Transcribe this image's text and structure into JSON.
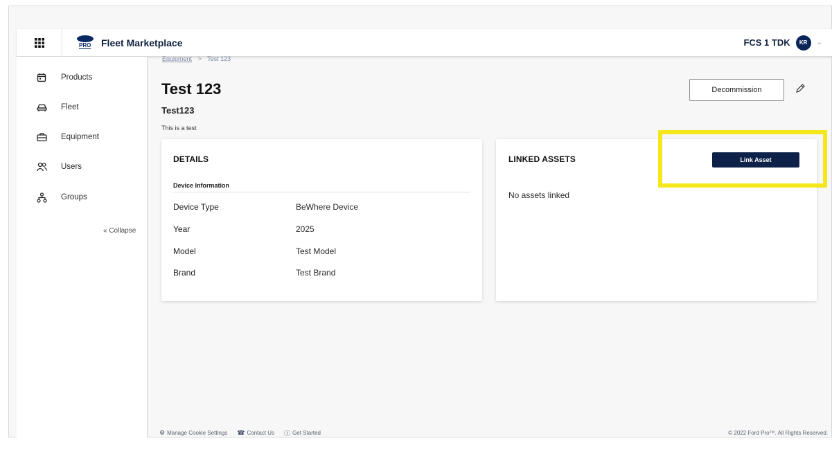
{
  "header": {
    "brand_title": "Fleet Marketplace",
    "logo_text": "PRO",
    "org_name": "FCS 1 TDK",
    "avatar_initials": "KR"
  },
  "sidebar": {
    "items": [
      {
        "label": "Products",
        "icon": "calendar-icon"
      },
      {
        "label": "Fleet",
        "icon": "car-icon"
      },
      {
        "label": "Equipment",
        "icon": "briefcase-icon"
      },
      {
        "label": "Users",
        "icon": "users-icon"
      },
      {
        "label": "Groups",
        "icon": "hierarchy-icon"
      }
    ],
    "collapse_label": "« Collapse"
  },
  "breadcrumb": {
    "parent": "Equipment",
    "separator": ">",
    "current": "Test 123"
  },
  "page": {
    "title": "Test 123",
    "subtitle": "Test123",
    "description": "This is a test",
    "decommission_label": "Decommission"
  },
  "details": {
    "heading": "DETAILS",
    "section_label": "Device Information",
    "rows": [
      {
        "key": "Device Type",
        "value": "BeWhere Device"
      },
      {
        "key": "Year",
        "value": "2025"
      },
      {
        "key": "Model",
        "value": "Test Model"
      },
      {
        "key": "Brand",
        "value": "Test Brand"
      }
    ]
  },
  "linked_assets": {
    "heading": "LINKED ASSETS",
    "empty_text": "No assets linked",
    "link_button_label": "Link Asset"
  },
  "footer": {
    "cookie_label": "Manage Cookie Settings",
    "contact_label": "Contact Us",
    "started_label": "Get Started",
    "copyright": "© 2022 Ford Pro™. All Rights Reserved."
  },
  "colors": {
    "primary_navy": "#0e2249",
    "highlight_yellow": "#f4e81c"
  }
}
